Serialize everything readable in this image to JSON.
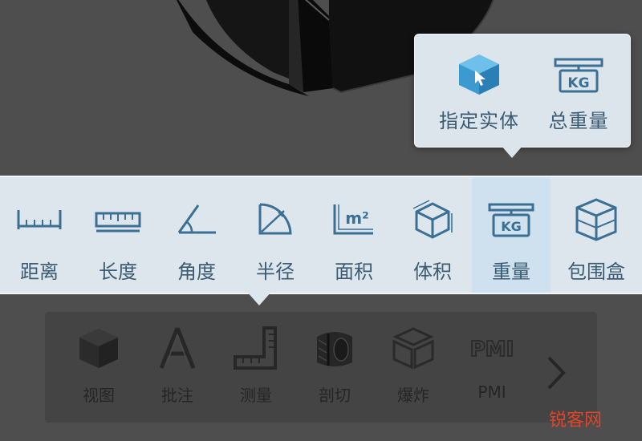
{
  "popup": {
    "items": [
      {
        "label": "指定实体",
        "icon": "select-solid-icon"
      },
      {
        "label": "总重量",
        "icon": "kg-scale-icon"
      }
    ]
  },
  "measure_toolbar": {
    "items": [
      {
        "label": "距离",
        "icon": "distance-ruler-icon"
      },
      {
        "label": "长度",
        "icon": "length-ruler-icon"
      },
      {
        "label": "角度",
        "icon": "angle-icon"
      },
      {
        "label": "半径",
        "icon": "radius-icon"
      },
      {
        "label": "面积",
        "icon": "area-m2-icon"
      },
      {
        "label": "体积",
        "icon": "volume-cube-icon"
      },
      {
        "label": "重量",
        "icon": "kg-weight-icon",
        "selected": true
      },
      {
        "label": "包围盒",
        "icon": "bounding-box-icon"
      }
    ],
    "accent": "#3b6f93",
    "selected_bg": "#cfe1ef"
  },
  "main_toolbar": {
    "items": [
      {
        "label": "视图",
        "icon": "view-cube-icon"
      },
      {
        "label": "批注",
        "icon": "annotation-a-icon"
      },
      {
        "label": "测量",
        "icon": "measure-ruler-icon"
      },
      {
        "label": "剖切",
        "icon": "section-cut-icon"
      },
      {
        "label": "爆炸",
        "icon": "explode-cube-icon"
      },
      {
        "label": "PMI",
        "icon": "pmi-icon"
      }
    ],
    "next_icon": "chevron-right-icon"
  },
  "watermark": {
    "part1": "锐客",
    "part2": "网"
  }
}
